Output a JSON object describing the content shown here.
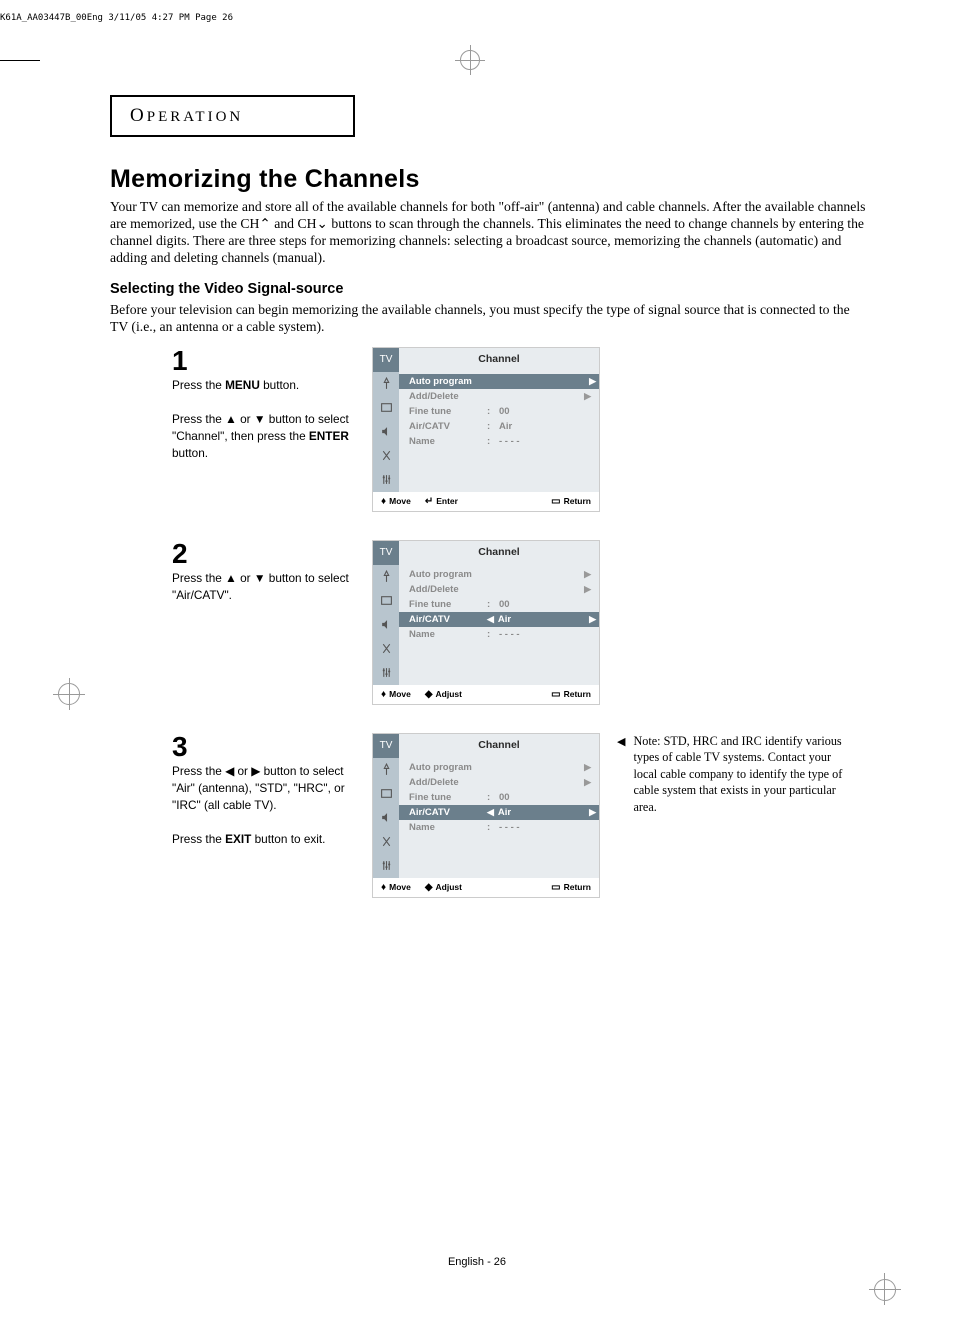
{
  "header_filename": "K61A_AA03447B_00Eng  3/11/05  4:27 PM  Page 26",
  "operation_label": "PERATION",
  "title": "Memorizing the Channels",
  "intro_text": "Your TV can memorize and store all of the available channels for both \"off-air\" (antenna) and cable channels. After the available channels are memorized, use the CH⌃ and CH⌄ buttons to scan through the channels. This eliminates the need to change channels by entering the channel digits. There are three steps for memorizing channels: selecting a broadcast source, memorizing the channels (automatic) and adding and deleting channels (manual).",
  "subtitle": "Selecting the Video Signal-source",
  "subtext": "Before your television can begin memorizing the available channels, you must specify the type of signal source that is connected to the TV (i.e., an antenna or a cable system).",
  "step1": {
    "num": "1",
    "line1a": "Press the ",
    "line1b": "MENU",
    "line1c": " button.",
    "line2": "Press the ▲ or ▼ button to select \"Channel\", then press the ",
    "line2b": "ENTER",
    "line2c": " button."
  },
  "step2": {
    "num": "2",
    "line1": "Press the ▲ or ▼ button to select \"Air/CATV\"."
  },
  "step3": {
    "num": "3",
    "line1": "Press the ◀ or ▶ button to select \"Air\" (antenna), \"STD\", \"HRC\", or \"IRC\" (all cable TV).",
    "line2a": "Press the ",
    "line2b": "EXIT",
    "line2c": " button to exit."
  },
  "menu": {
    "title": "Channel",
    "items": {
      "auto_program": "Auto program",
      "add_delete": "Add/Delete",
      "fine_tune": "Fine tune",
      "fine_tune_val": "00",
      "air_catv": "Air/CATV",
      "air_catv_val": "Air",
      "name": "Name",
      "name_val": "- - - -"
    },
    "footer": {
      "move": "Move",
      "enter": "Enter",
      "adjust": "Adjust",
      "return": "Return"
    },
    "tab": "TV"
  },
  "note": "Note: STD, HRC and IRC identify various types of cable TV systems. Contact your local cable company to identify the type of cable system that exists in your particular area.",
  "page_num": "English - 26"
}
